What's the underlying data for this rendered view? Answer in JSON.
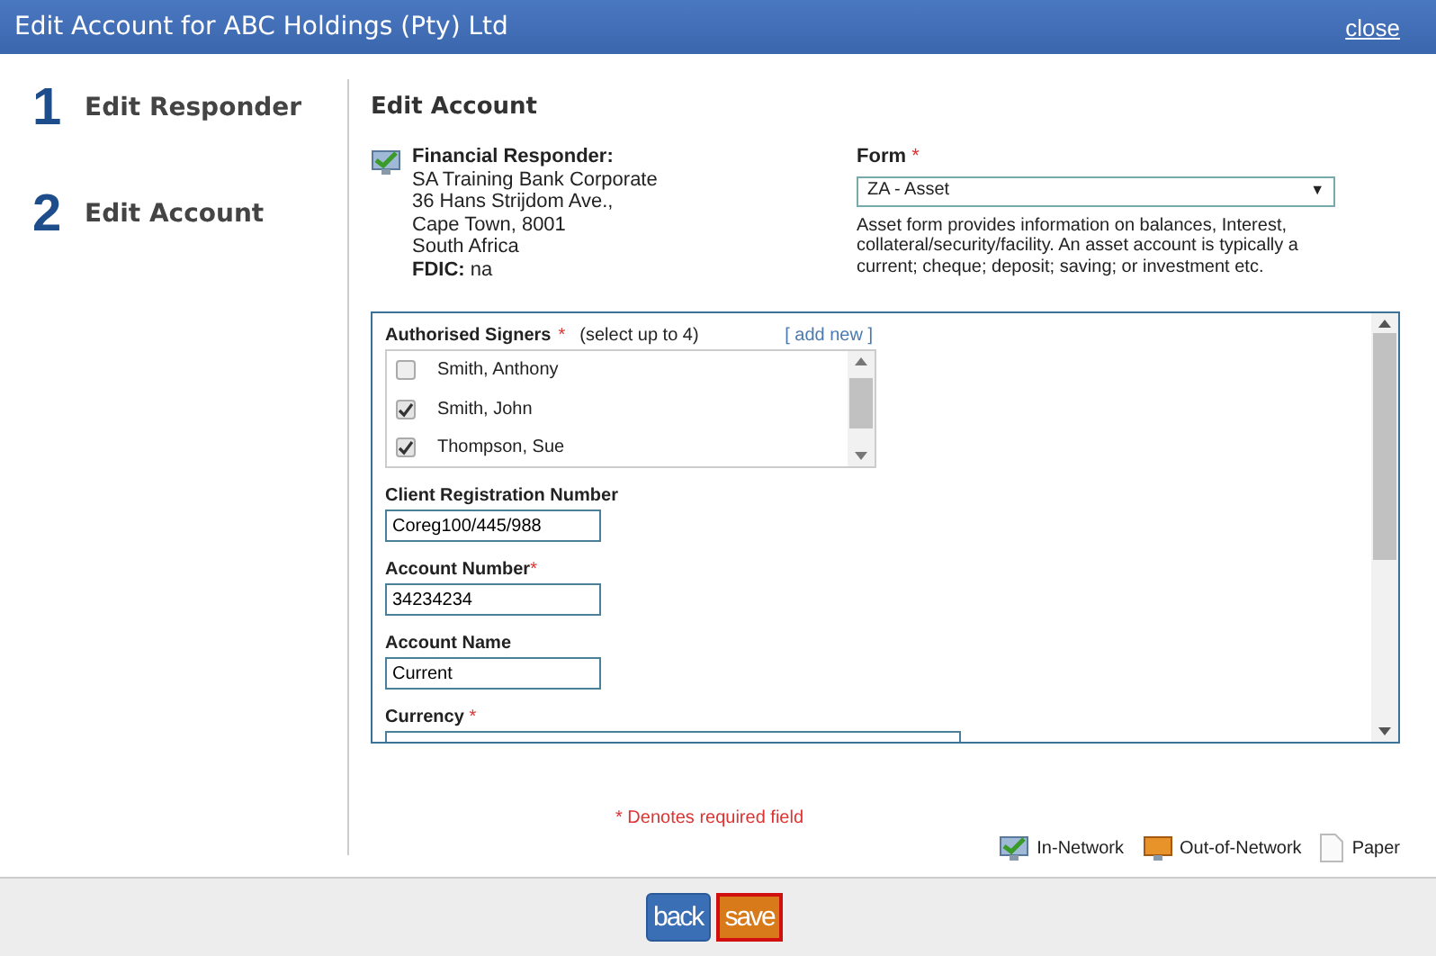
{
  "window": {
    "title": "Edit Account for ABC Holdings (Pty) Ltd",
    "close": "close"
  },
  "steps": [
    {
      "number": "1",
      "label": "Edit Responder"
    },
    {
      "number": "2",
      "label": "Edit Account"
    }
  ],
  "heading": "Edit Account",
  "responder": {
    "label": "Financial Responder:",
    "lines": [
      "SA Training Bank Corporate",
      "36 Hans Strijdom Ave.,",
      "Cape Town, 8001",
      "South Africa"
    ],
    "fdic_label": "FDIC:",
    "fdic_value": "na"
  },
  "form_field": {
    "label": "Form",
    "required": "*",
    "value": "ZA - Asset",
    "caret": "▼",
    "description": "Asset form provides information on balances, Interest, collateral/security/facility. An asset account is typically a current; cheque; deposit; saving; or investment etc."
  },
  "signers": {
    "label": "Authorised Signers",
    "required": "*",
    "hint": "(select up to 4)",
    "add_new": "[ add new ]",
    "items": [
      {
        "name": "Smith, Anthony",
        "checked": false
      },
      {
        "name": "Smith, John",
        "checked": true
      },
      {
        "name": "Thompson, Sue",
        "checked": true
      }
    ]
  },
  "fields": [
    {
      "label": "Client Registration Number",
      "required": false,
      "value": "Coreg100/445/988"
    },
    {
      "label": "Account Number",
      "required": true,
      "value": "34234234"
    },
    {
      "label": "Account Name",
      "required": false,
      "value": "Current"
    }
  ],
  "currency": {
    "label": "Currency",
    "required": "*"
  },
  "required_note": "* Denotes required field",
  "legend": [
    {
      "kind": "in",
      "label": "In-Network"
    },
    {
      "kind": "out",
      "label": "Out-of-Network"
    },
    {
      "kind": "paper",
      "label": "Paper"
    }
  ],
  "buttons": [
    {
      "kind": "back",
      "label": "back"
    },
    {
      "kind": "save",
      "label": "save"
    }
  ]
}
